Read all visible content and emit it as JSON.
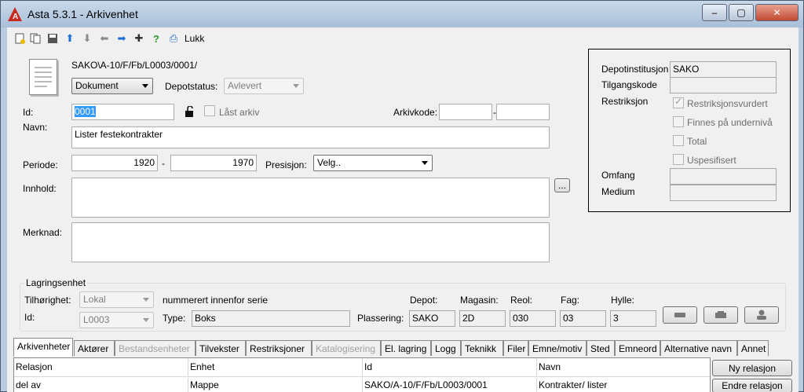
{
  "window": {
    "title": "Asta 5.3.1 - Arkivenhet",
    "controls": {
      "minimize": "–",
      "maximize": "▢",
      "close": "✕"
    }
  },
  "toolbar": {
    "icons": [
      "new-doc-icon",
      "copy-icon",
      "save-icon",
      "arrow-up-icon",
      "arrow-down-icon",
      "arrow-left-icon",
      "arrow-right-icon",
      "add-star-icon",
      "help-icon",
      "print-icon"
    ],
    "close_label": "Lukk"
  },
  "header": {
    "path": "SAKO\\A-10/F/Fb/L0003/0001/",
    "doc_type": "Dokument",
    "depotstatus_label": "Depotstatus:",
    "depotstatus_value": "Avlevert"
  },
  "form": {
    "id_label": "Id:",
    "id_value": "0001",
    "locked_label": "Låst arkiv",
    "arkivkode_label": "Arkivkode:",
    "arkivkode_sep": "-",
    "navn_label": "Navn:",
    "navn_value": "Lister festekontrakter",
    "periode_label": "Periode:",
    "periode_from": "1920",
    "periode_sep": "-",
    "periode_to": "1970",
    "presisjon_label": "Presisjon:",
    "presisjon_value": "Velg..",
    "innhold_label": "Innhold:",
    "innhold_btn": "...",
    "merknad_label": "Merknad:"
  },
  "depot_panel": {
    "institusjon_label": "Depotinstitusjon",
    "institusjon_value": "SAKO",
    "tilgangskode_label": "Tilgangskode",
    "restriksjon_label": "Restriksjon",
    "checks": [
      {
        "label": "Restriksjonsvurdert",
        "checked": true
      },
      {
        "label": "Finnes på undernivå",
        "checked": false
      },
      {
        "label": "Total",
        "checked": false
      },
      {
        "label": "Uspesifisert",
        "checked": false
      }
    ],
    "omfang_label": "Omfang",
    "medium_label": "Medium"
  },
  "lagring": {
    "title": "Lagringsenhet",
    "tilhorighet_label": "Tilhørighet:",
    "tilhorighet_value": "Lokal",
    "nummerert_text": "nummerert innenfor serie",
    "id_label": "Id:",
    "id_value": "L0003",
    "type_label": "Type:",
    "type_value": "Boks",
    "plassering_label": "Plassering:",
    "depot_label": "Depot:",
    "depot_value": "SAKO",
    "magasin_label": "Magasin:",
    "magasin_value": "2D",
    "reol_label": "Reol:",
    "reol_value": "030",
    "fag_label": "Fag:",
    "fag_value": "03",
    "hylle_label": "Hylle:",
    "hylle_value": "3"
  },
  "tabs": [
    {
      "label": "Arkivenheter",
      "state": "active"
    },
    {
      "label": "Aktører",
      "state": "normal"
    },
    {
      "label": "Bestandsenheter",
      "state": "disabled"
    },
    {
      "label": "Tilvekster",
      "state": "normal"
    },
    {
      "label": "Restriksjoner",
      "state": "normal"
    },
    {
      "label": "Katalogisering",
      "state": "disabled"
    },
    {
      "label": "El. lagring",
      "state": "normal"
    },
    {
      "label": "Logg",
      "state": "normal"
    },
    {
      "label": "Teknikk",
      "state": "normal"
    },
    {
      "label": "Filer",
      "state": "normal"
    },
    {
      "label": "Emne/motiv",
      "state": "normal"
    },
    {
      "label": "Sted",
      "state": "normal"
    },
    {
      "label": "Emneord",
      "state": "normal"
    },
    {
      "label": "Alternative navn",
      "state": "normal"
    },
    {
      "label": "Annet",
      "state": "normal"
    }
  ],
  "grid": {
    "columns": [
      "Relasjon",
      "Enhet",
      "Id",
      "Navn"
    ],
    "rows": [
      [
        "del av",
        "Mappe",
        "SAKO/A-10/F/Fb/L0003/0001",
        "Kontrakter/ lister"
      ]
    ]
  },
  "side_buttons": {
    "new_relation": "Ny relasjon",
    "edit_relation": "Endre relasjon"
  }
}
